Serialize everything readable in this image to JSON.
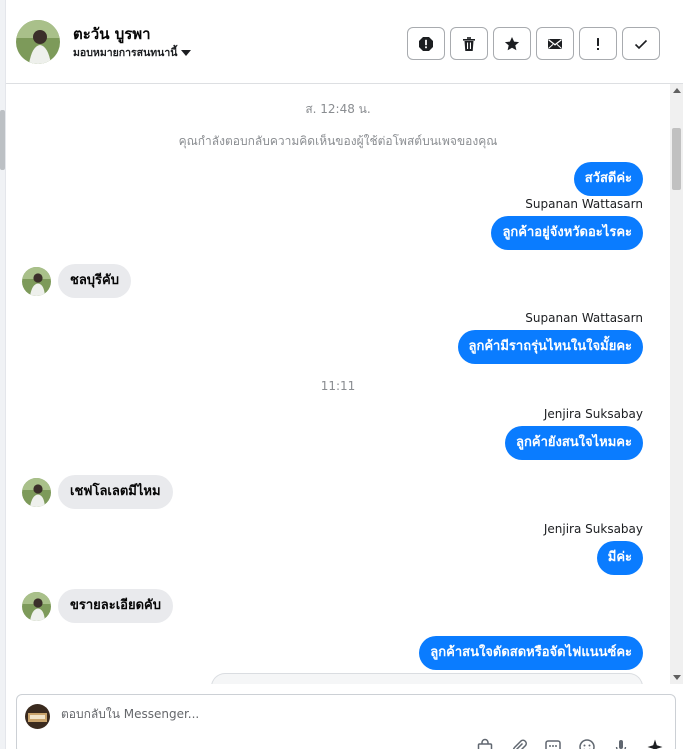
{
  "header": {
    "contact_name": "ตะวัน บูรพา",
    "assign_label": "มอบหมายการสนทนานี้",
    "actions": [
      {
        "icon": "alert-octagon-icon",
        "name": "mark-spam-button"
      },
      {
        "icon": "trash-icon",
        "name": "delete-button"
      },
      {
        "icon": "star-icon",
        "name": "star-button"
      },
      {
        "icon": "envelope-icon",
        "name": "mark-unread-button"
      },
      {
        "icon": "exclamation-icon",
        "name": "follow-up-button"
      },
      {
        "icon": "checkmark-icon",
        "name": "mark-done-button"
      }
    ]
  },
  "thread": {
    "timestamp_1": "ส. 12:48 น.",
    "reply_notice": "คุณกำลังตอบกลับความคิดเห็นของผู้ใช้ต่อโพสต์บนเพจของคุณ",
    "timestamp_2": "11:11",
    "messages": [
      {
        "dir": "out",
        "sender": "",
        "text": "สวัสดีค่ะ"
      },
      {
        "dir": "out",
        "sender": "Supanan Wattasarn",
        "text": "ลูกค้าอยู่จังหวัดอะไรคะ"
      },
      {
        "dir": "in",
        "text": "ชลบุรีคับ"
      },
      {
        "dir": "out",
        "sender": "Supanan Wattasarn",
        "text": "ลูกค้ามีราถรุ่นไหนในใจมั้ยคะ"
      },
      {
        "dir": "out",
        "sender": "Jenjira Suksabay",
        "text": "ลูกค้ายังสนใจไหมคะ"
      },
      {
        "dir": "in",
        "text": "เชฟโลเลตมีไหม"
      },
      {
        "dir": "out",
        "sender": "Jenjira Suksabay",
        "text": "มีค่ะ"
      },
      {
        "dir": "in",
        "text": "ขรายละเอียดคับ"
      },
      {
        "dir": "out",
        "sender": "",
        "text": "ลูกค้าสนใจดัดสดหรือจัดไฟแนนซ์คะ"
      }
    ]
  },
  "composer": {
    "placeholder": "ตอบกลับใน Messenger...",
    "tools": [
      "bag-icon",
      "paperclip-icon",
      "chat-bubble-icon",
      "emoji-icon",
      "microphone-icon",
      "sparkle-icon"
    ]
  },
  "colors": {
    "outgoing_bubble": "#0a7cff",
    "incoming_bubble": "#e9eaed"
  }
}
